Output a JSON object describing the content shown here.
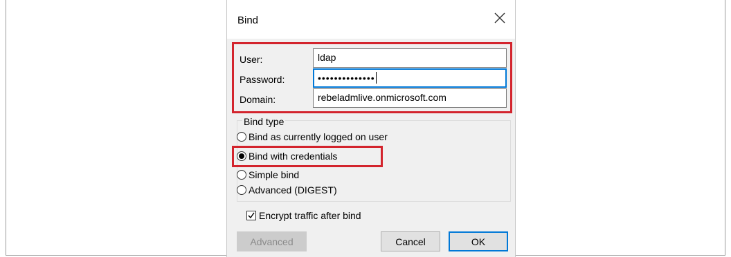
{
  "dialog": {
    "title": "Bind",
    "close_icon": "close-icon"
  },
  "fields": {
    "user_label": "User:",
    "user_value": "ldap",
    "password_label": "Password:",
    "password_value": "••••••••••••••",
    "domain_label": "Domain:",
    "domain_value": "rebeladmlive.onmicrosoft.com"
  },
  "bind_type": {
    "legend": "Bind type",
    "options": [
      {
        "label": "Bind as currently logged on user",
        "checked": false
      },
      {
        "label": "Bind with credentials",
        "checked": true
      },
      {
        "label": "Simple bind",
        "checked": false
      },
      {
        "label": "Advanced (DIGEST)",
        "checked": false
      }
    ]
  },
  "encrypt": {
    "label": "Encrypt traffic after bind",
    "checked": true
  },
  "buttons": {
    "advanced": "Advanced",
    "cancel": "Cancel",
    "ok": "OK"
  },
  "colors": {
    "highlight": "#d3242d",
    "focus": "#0078d7"
  }
}
